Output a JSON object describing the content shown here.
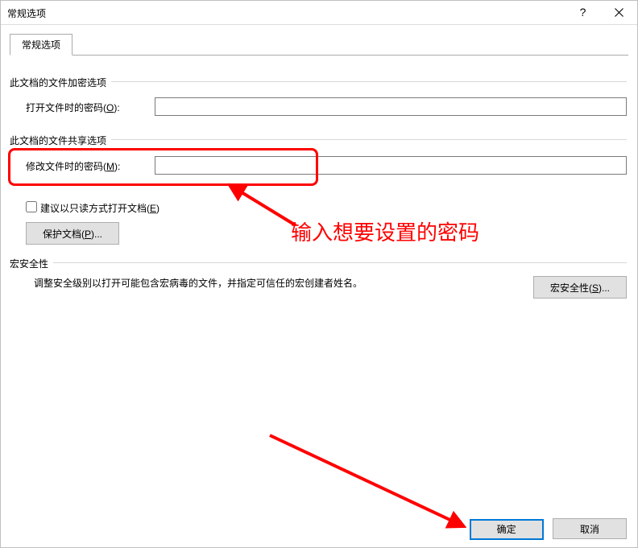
{
  "window": {
    "title": "常规选项"
  },
  "tab": {
    "label": "常规选项"
  },
  "encrypt": {
    "group_title": "此文档的文件加密选项",
    "open_pw_label": "打开文件时的密码(",
    "open_pw_hotkey": "O",
    "open_pw_label_tail": "):",
    "open_pw_value": ""
  },
  "share": {
    "group_title": "此文档的文件共享选项",
    "modify_pw_label": "修改文件时的密码(",
    "modify_pw_hotkey": "M",
    "modify_pw_label_tail": "):",
    "modify_pw_value": "",
    "readonly_label": "建议以只读方式打开文档(",
    "readonly_hotkey": "E",
    "readonly_label_tail": ")",
    "protect_btn": "保护文档(",
    "protect_btn_hotkey": "P",
    "protect_btn_tail": ")..."
  },
  "macro": {
    "group_title": "宏安全性",
    "desc": "调整安全级别以打开可能包含宏病毒的文件，并指定可信任的宏创建者姓名。",
    "btn": "宏安全性(",
    "btn_hotkey": "S",
    "btn_tail": ")..."
  },
  "footer": {
    "ok": "确定",
    "cancel": "取消"
  },
  "annotation": {
    "text": "输入想要设置的密码"
  }
}
